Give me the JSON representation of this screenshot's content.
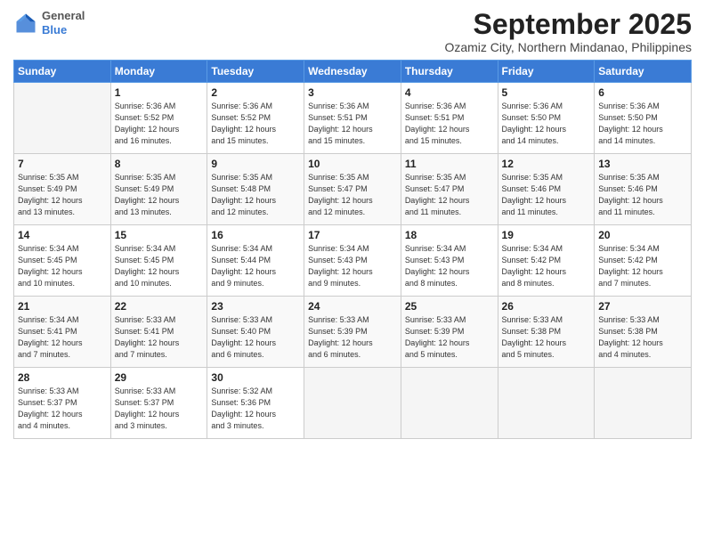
{
  "logo": {
    "general": "General",
    "blue": "Blue"
  },
  "title": "September 2025",
  "subtitle": "Ozamiz City, Northern Mindanao, Philippines",
  "days_of_week": [
    "Sunday",
    "Monday",
    "Tuesday",
    "Wednesday",
    "Thursday",
    "Friday",
    "Saturday"
  ],
  "weeks": [
    [
      {
        "day": "",
        "info": ""
      },
      {
        "day": "1",
        "info": "Sunrise: 5:36 AM\nSunset: 5:52 PM\nDaylight: 12 hours\nand 16 minutes."
      },
      {
        "day": "2",
        "info": "Sunrise: 5:36 AM\nSunset: 5:52 PM\nDaylight: 12 hours\nand 15 minutes."
      },
      {
        "day": "3",
        "info": "Sunrise: 5:36 AM\nSunset: 5:51 PM\nDaylight: 12 hours\nand 15 minutes."
      },
      {
        "day": "4",
        "info": "Sunrise: 5:36 AM\nSunset: 5:51 PM\nDaylight: 12 hours\nand 15 minutes."
      },
      {
        "day": "5",
        "info": "Sunrise: 5:36 AM\nSunset: 5:50 PM\nDaylight: 12 hours\nand 14 minutes."
      },
      {
        "day": "6",
        "info": "Sunrise: 5:36 AM\nSunset: 5:50 PM\nDaylight: 12 hours\nand 14 minutes."
      }
    ],
    [
      {
        "day": "7",
        "info": "Sunrise: 5:35 AM\nSunset: 5:49 PM\nDaylight: 12 hours\nand 13 minutes."
      },
      {
        "day": "8",
        "info": "Sunrise: 5:35 AM\nSunset: 5:49 PM\nDaylight: 12 hours\nand 13 minutes."
      },
      {
        "day": "9",
        "info": "Sunrise: 5:35 AM\nSunset: 5:48 PM\nDaylight: 12 hours\nand 12 minutes."
      },
      {
        "day": "10",
        "info": "Sunrise: 5:35 AM\nSunset: 5:47 PM\nDaylight: 12 hours\nand 12 minutes."
      },
      {
        "day": "11",
        "info": "Sunrise: 5:35 AM\nSunset: 5:47 PM\nDaylight: 12 hours\nand 11 minutes."
      },
      {
        "day": "12",
        "info": "Sunrise: 5:35 AM\nSunset: 5:46 PM\nDaylight: 12 hours\nand 11 minutes."
      },
      {
        "day": "13",
        "info": "Sunrise: 5:35 AM\nSunset: 5:46 PM\nDaylight: 12 hours\nand 11 minutes."
      }
    ],
    [
      {
        "day": "14",
        "info": "Sunrise: 5:34 AM\nSunset: 5:45 PM\nDaylight: 12 hours\nand 10 minutes."
      },
      {
        "day": "15",
        "info": "Sunrise: 5:34 AM\nSunset: 5:45 PM\nDaylight: 12 hours\nand 10 minutes."
      },
      {
        "day": "16",
        "info": "Sunrise: 5:34 AM\nSunset: 5:44 PM\nDaylight: 12 hours\nand 9 minutes."
      },
      {
        "day": "17",
        "info": "Sunrise: 5:34 AM\nSunset: 5:43 PM\nDaylight: 12 hours\nand 9 minutes."
      },
      {
        "day": "18",
        "info": "Sunrise: 5:34 AM\nSunset: 5:43 PM\nDaylight: 12 hours\nand 8 minutes."
      },
      {
        "day": "19",
        "info": "Sunrise: 5:34 AM\nSunset: 5:42 PM\nDaylight: 12 hours\nand 8 minutes."
      },
      {
        "day": "20",
        "info": "Sunrise: 5:34 AM\nSunset: 5:42 PM\nDaylight: 12 hours\nand 7 minutes."
      }
    ],
    [
      {
        "day": "21",
        "info": "Sunrise: 5:34 AM\nSunset: 5:41 PM\nDaylight: 12 hours\nand 7 minutes."
      },
      {
        "day": "22",
        "info": "Sunrise: 5:33 AM\nSunset: 5:41 PM\nDaylight: 12 hours\nand 7 minutes."
      },
      {
        "day": "23",
        "info": "Sunrise: 5:33 AM\nSunset: 5:40 PM\nDaylight: 12 hours\nand 6 minutes."
      },
      {
        "day": "24",
        "info": "Sunrise: 5:33 AM\nSunset: 5:39 PM\nDaylight: 12 hours\nand 6 minutes."
      },
      {
        "day": "25",
        "info": "Sunrise: 5:33 AM\nSunset: 5:39 PM\nDaylight: 12 hours\nand 5 minutes."
      },
      {
        "day": "26",
        "info": "Sunrise: 5:33 AM\nSunset: 5:38 PM\nDaylight: 12 hours\nand 5 minutes."
      },
      {
        "day": "27",
        "info": "Sunrise: 5:33 AM\nSunset: 5:38 PM\nDaylight: 12 hours\nand 4 minutes."
      }
    ],
    [
      {
        "day": "28",
        "info": "Sunrise: 5:33 AM\nSunset: 5:37 PM\nDaylight: 12 hours\nand 4 minutes."
      },
      {
        "day": "29",
        "info": "Sunrise: 5:33 AM\nSunset: 5:37 PM\nDaylight: 12 hours\nand 3 minutes."
      },
      {
        "day": "30",
        "info": "Sunrise: 5:32 AM\nSunset: 5:36 PM\nDaylight: 12 hours\nand 3 minutes."
      },
      {
        "day": "",
        "info": ""
      },
      {
        "day": "",
        "info": ""
      },
      {
        "day": "",
        "info": ""
      },
      {
        "day": "",
        "info": ""
      }
    ]
  ]
}
